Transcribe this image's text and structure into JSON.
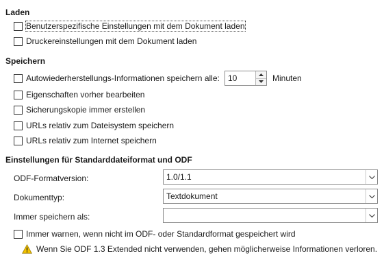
{
  "load": {
    "title": "Laden",
    "options": [
      {
        "label": "Benutzerspezifische Einstellungen mit dem Dokument laden",
        "checked": false
      },
      {
        "label": "Druckereinstellungen mit dem Dokument laden",
        "checked": false
      }
    ]
  },
  "save": {
    "title": "Speichern",
    "autorecovery": {
      "label": "Autowiederherstellungs-Informationen speichern alle:",
      "value": "10",
      "unit": "Minuten",
      "checked": false
    },
    "options": [
      {
        "label": "Eigenschaften vorher bearbeiten",
        "checked": false
      },
      {
        "label": "Sicherungskopie immer erstellen",
        "checked": false
      },
      {
        "label": "URLs relativ zum Dateisystem speichern",
        "checked": false
      },
      {
        "label": "URLs relativ zum Internet speichern",
        "checked": false
      }
    ]
  },
  "defaults": {
    "title": "Einstellungen für Standarddateiformat und ODF",
    "odf_version": {
      "label": "ODF-Formatversion:",
      "value": "1.0/1.1"
    },
    "doc_type": {
      "label": "Dokumenttyp:",
      "value": "Textdokument"
    },
    "always_save_as": {
      "label": "Immer speichern als:",
      "value": ""
    },
    "warn": {
      "label": "Immer warnen, wenn nicht im ODF- oder Standardformat gespeichert wird",
      "checked": false
    },
    "warning": "Wenn Sie ODF 1.3 Extended nicht verwenden, gehen möglicherweise Informationen verloren."
  },
  "colors": {
    "warning_fill": "#f5c400",
    "border": "#8a8a8a"
  }
}
